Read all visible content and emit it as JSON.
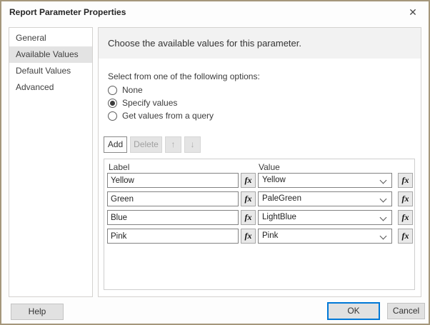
{
  "dialog": {
    "title": "Report Parameter Properties",
    "close_glyph": "✕"
  },
  "sidebar": {
    "items": [
      {
        "label": "General",
        "selected": false
      },
      {
        "label": "Available Values",
        "selected": true
      },
      {
        "label": "Default Values",
        "selected": false
      },
      {
        "label": "Advanced",
        "selected": false
      }
    ]
  },
  "main": {
    "heading": "Choose the available values for this parameter.",
    "options_label": "Select from one of the following options:",
    "radios": [
      {
        "label": "None",
        "selected": false
      },
      {
        "label": "Specify values",
        "selected": true
      },
      {
        "label": "Get values from a query",
        "selected": false
      }
    ],
    "toolbar": {
      "add_label": "Add",
      "delete_label": "Delete",
      "up_glyph": "↑",
      "down_glyph": "↓"
    },
    "table": {
      "columns": {
        "label": "Label",
        "value": "Value"
      },
      "fx_label": "fx",
      "rows": [
        {
          "label": "Yellow",
          "value": "Yellow"
        },
        {
          "label": "Green",
          "value": "PaleGreen"
        },
        {
          "label": "Blue",
          "value": "LightBlue"
        },
        {
          "label": "Pink",
          "value": "Pink"
        }
      ]
    }
  },
  "footer": {
    "help_label": "Help",
    "ok_label": "OK",
    "cancel_label": "Cancel"
  },
  "colors": {
    "accent": "#0078d7",
    "window_border": "#a5977b",
    "selected_item_bg": "#e3e3e3"
  }
}
